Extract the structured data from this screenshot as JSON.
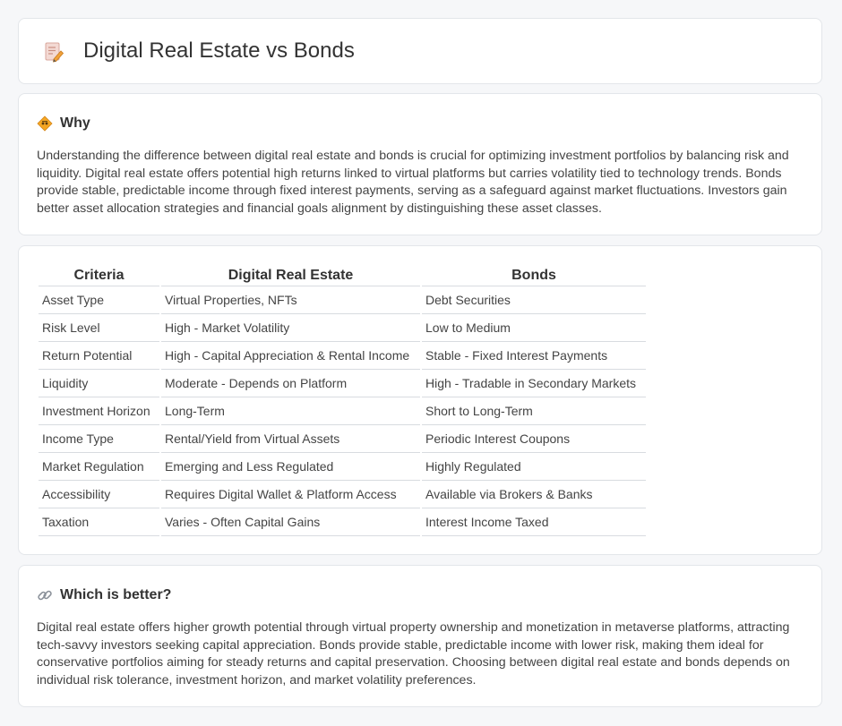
{
  "header": {
    "title": "Digital Real Estate vs Bonds",
    "icon": "document-pencil-icon"
  },
  "why": {
    "heading": "Why",
    "icon": "diamond-icon",
    "text": "Understanding the difference between digital real estate and bonds is crucial for optimizing investment portfolios by balancing risk and liquidity. Digital real estate offers potential high returns linked to virtual platforms but carries volatility tied to technology trends. Bonds provide stable, predictable income through fixed interest payments, serving as a safeguard against market fluctuations. Investors gain better asset allocation strategies and financial goals alignment by distinguishing these asset classes."
  },
  "comparison": {
    "headers": [
      "Criteria",
      "Digital Real Estate",
      "Bonds"
    ],
    "rows": [
      [
        "Asset Type",
        "Virtual Properties, NFTs",
        "Debt Securities"
      ],
      [
        "Risk Level",
        "High - Market Volatility",
        "Low to Medium"
      ],
      [
        "Return Potential",
        "High - Capital Appreciation & Rental Income",
        "Stable - Fixed Interest Payments"
      ],
      [
        "Liquidity",
        "Moderate - Depends on Platform",
        "High - Tradable in Secondary Markets"
      ],
      [
        "Investment Horizon",
        "Long-Term",
        "Short to Long-Term"
      ],
      [
        "Income Type",
        "Rental/Yield from Virtual Assets",
        "Periodic Interest Coupons"
      ],
      [
        "Market Regulation",
        "Emerging and Less Regulated",
        "Highly Regulated"
      ],
      [
        "Accessibility",
        "Requires Digital Wallet & Platform Access",
        "Available via Brokers & Banks"
      ],
      [
        "Taxation",
        "Varies - Often Capital Gains",
        "Interest Income Taxed"
      ]
    ]
  },
  "better": {
    "heading": "Which is better?",
    "icon": "link-icon",
    "text": "Digital real estate offers higher growth potential through virtual property ownership and monetization in metaverse platforms, attracting tech-savvy investors seeking capital appreciation. Bonds provide stable, predictable income with lower risk, making them ideal for conservative portfolios aiming for steady returns and capital preservation. Choosing between digital real estate and bonds depends on individual risk tolerance, investment horizon, and market volatility preferences."
  }
}
